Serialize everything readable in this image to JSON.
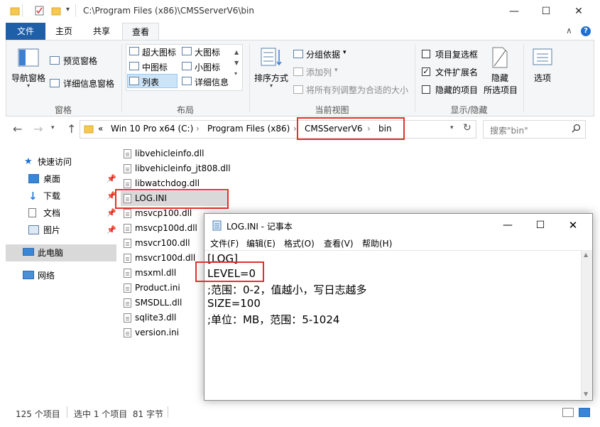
{
  "explorer": {
    "title_path": "C:\\Program Files (x86)\\CMSServerV6\\bin",
    "window_buttons": {
      "minimize": "—",
      "maximize": "☐",
      "close": "✕"
    },
    "tabs": [
      {
        "label": "文件"
      },
      {
        "label": "主页"
      },
      {
        "label": "共享"
      },
      {
        "label": "查看"
      }
    ],
    "ribbon_collapse": "∧",
    "help": "?",
    "ribbon": {
      "panes": {
        "nav_pane": "导航窗格",
        "preview_pane": "预览窗格",
        "details_pane": "详细信息窗格",
        "group_label": "窗格"
      },
      "layout": {
        "items": [
          "超大图标",
          "大图标",
          "中图标",
          "小图标",
          "列表",
          "详细信息"
        ],
        "group_label": "布局"
      },
      "current_view": {
        "sort_by": "排序方式",
        "group_by": "分组依据",
        "add_columns": "添加列",
        "fit_columns": "将所有列调整为合适的大小",
        "group_label": "当前视图"
      },
      "show_hide": {
        "item_checkboxes": "项目复选框",
        "file_extensions": "文件扩展名",
        "hidden_items": "隐藏的项目",
        "hide_selected_line1": "隐藏",
        "hide_selected_line2": "所选项目",
        "group_label": "显示/隐藏"
      },
      "options": "选项"
    },
    "address": {
      "prefix": "«",
      "crumbs": [
        "Win 10 Pro x64 (C:)",
        "Program Files (x86)",
        "CMSServerV6",
        "bin"
      ],
      "separator": "›"
    },
    "search_placeholder": "搜索\"bin\"",
    "nav": {
      "quick_access": "快速访问",
      "items": [
        "桌面",
        "下载",
        "文档",
        "图片"
      ],
      "this_pc": "此电脑",
      "network": "网络"
    },
    "files": [
      "libvehicleinfo.dll",
      "libvehicleinfo_jt808.dll",
      "libwatchdog.dll",
      "LOG.INI",
      "msvcp100.dll",
      "msvcp100d.dll",
      "msvcr100.dll",
      "msvcr100d.dll",
      "msxml.dll",
      "Product.ini",
      "SMSDLL.dll",
      "sqlite3.dll",
      "version.ini"
    ],
    "status": {
      "count": "125 个项目",
      "selected": "选中 1 个项目  81 字节"
    }
  },
  "notepad": {
    "title": "LOG.INI - 记事本",
    "menu": [
      "文件(F)",
      "编辑(E)",
      "格式(O)",
      "查看(V)",
      "帮助(H)"
    ],
    "lines": [
      "[LOG]",
      "LEVEL=0",
      ";范围：0-2，值越小，写日志越多",
      "SIZE=100",
      ";单位：MB，范围：5-1024"
    ]
  },
  "colors": {
    "accent": "#1f5fa8",
    "highlight": "#e0322d",
    "selected_row": "#d9d9d9",
    "folder": "#f6c94e"
  }
}
